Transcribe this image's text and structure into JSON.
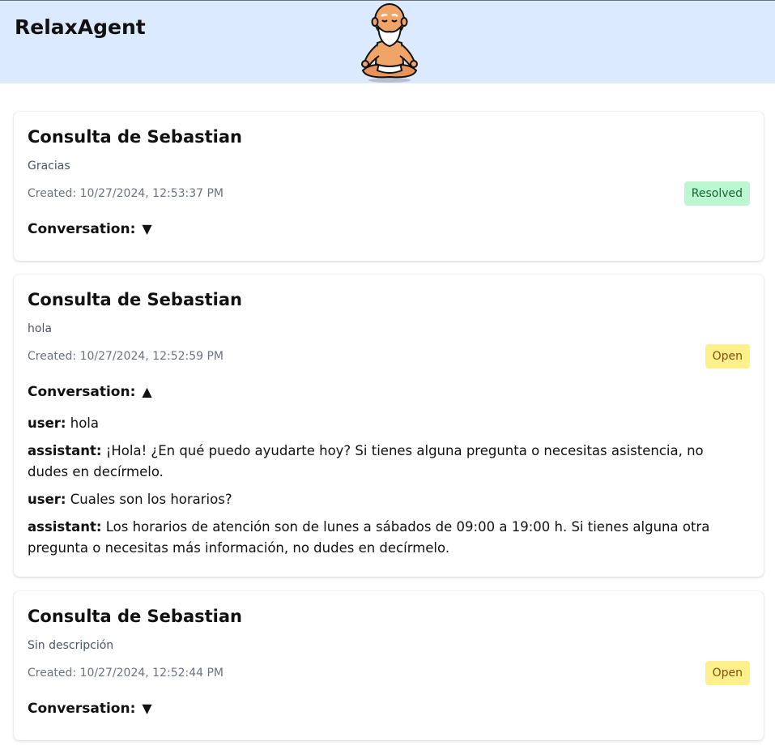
{
  "app": {
    "title": "RelaxAgent"
  },
  "colors": {
    "header_bg": "#dbeafe",
    "resolved_bg": "#bbf7d0",
    "resolved_text": "#166534",
    "open_bg": "#fef08a",
    "open_text": "#854d0e"
  },
  "icons": {
    "mascot": "meditating-monk-icon",
    "collapsed": "triangle-down-icon",
    "expanded": "triangle-up-icon"
  },
  "tickets": [
    {
      "title": "Consulta de Sebastian",
      "description": "Gracias",
      "created": "Created: 10/27/2024, 12:53:37 PM",
      "status": "Resolved",
      "conversation_label": "Conversation:",
      "arrow": "▼",
      "expanded": false,
      "messages": []
    },
    {
      "title": "Consulta de Sebastian",
      "description": "hola",
      "created": "Created: 10/27/2024, 12:52:59 PM",
      "status": "Open",
      "conversation_label": "Conversation:",
      "arrow": "▲",
      "expanded": true,
      "messages": [
        {
          "role": "user:",
          "text": "hola"
        },
        {
          "role": "assistant:",
          "text": "¡Hola! ¿En qué puedo ayudarte hoy? Si tienes alguna pregunta o necesitas asistencia, no dudes en decírmelo."
        },
        {
          "role": "user:",
          "text": "Cuales son los horarios?"
        },
        {
          "role": "assistant:",
          "text": "Los horarios de atención son de lunes a sábados de 09:00 a 19:00 h. Si tienes alguna otra pregunta o necesitas más información, no dudes en decírmelo."
        }
      ]
    },
    {
      "title": "Consulta de Sebastian",
      "description": "Sin descripción",
      "created": "Created: 10/27/2024, 12:52:44 PM",
      "status": "Open",
      "conversation_label": "Conversation:",
      "arrow": "▼",
      "expanded": false,
      "messages": []
    }
  ]
}
